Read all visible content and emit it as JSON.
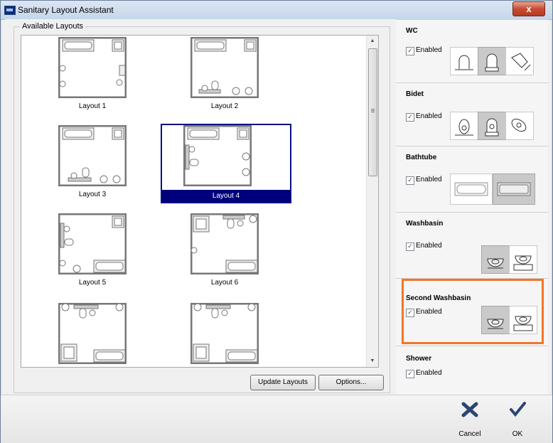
{
  "window": {
    "title": "Sanitary Layout Assistant",
    "close_glyph": "x"
  },
  "layouts": {
    "legend": "Available Layouts",
    "items": [
      "Layout 1",
      "Layout 2",
      "Layout 3",
      "Layout 4",
      "Layout 5",
      "Layout 6",
      "",
      ""
    ],
    "selected": "Layout 4"
  },
  "buttons": {
    "update": "Update Layouts",
    "options": "Options..."
  },
  "sections": [
    {
      "name": "WC",
      "enabled_label": "Enabled",
      "icons": [
        "wc-front-icon",
        "wc-front-selected-icon",
        "wc-side-icon"
      ]
    },
    {
      "name": "Bidet",
      "enabled_label": "Enabled",
      "icons": [
        "bidet-front-icon",
        "bidet-front-selected-icon",
        "bidet-side-icon"
      ]
    },
    {
      "name": "Bathtube",
      "enabled_label": "Enabled",
      "icons": [
        "bathtub-plain-icon",
        "bathtub-selected-icon"
      ]
    },
    {
      "name": "Washbasin",
      "enabled_label": "Enabled",
      "icons": [
        "washbasin-selected-icon",
        "washbasin-cabinet-icon"
      ]
    },
    {
      "name": "Second Washbasin",
      "enabled_label": "Enabled",
      "icons": [
        "washbasin-selected-icon",
        "washbasin-cabinet-icon"
      ]
    },
    {
      "name": "Shower",
      "enabled_label": "Enabled",
      "icons": []
    }
  ],
  "actions": {
    "cancel": "Cancel",
    "ok": "OK"
  },
  "colors": {
    "highlight": "#f37528",
    "selection": "#00007c"
  }
}
